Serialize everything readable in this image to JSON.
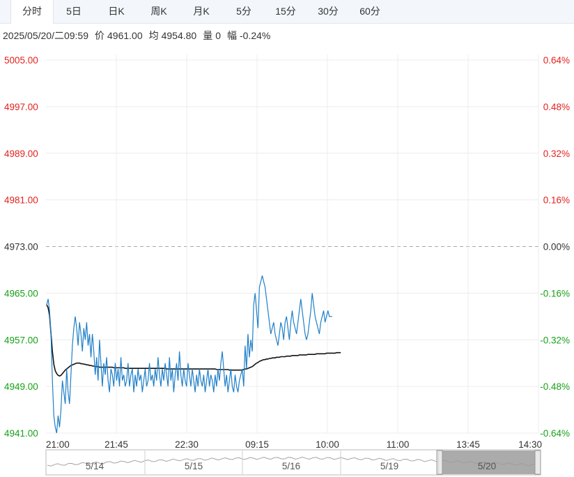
{
  "tabs": [
    {
      "label": "分时",
      "active": true
    },
    {
      "label": "5日",
      "active": false
    },
    {
      "label": "日K",
      "active": false
    },
    {
      "label": "周K",
      "active": false
    },
    {
      "label": "月K",
      "active": false
    },
    {
      "label": "5分",
      "active": false
    },
    {
      "label": "15分",
      "active": false
    },
    {
      "label": "30分",
      "active": false
    },
    {
      "label": "60分",
      "active": false
    }
  ],
  "info": {
    "datetime": "2025/05/20/二09:59",
    "price_label": "价",
    "price": "4961.00",
    "avg_label": "均",
    "avg": "4954.80",
    "volume_label": "量",
    "volume": "0",
    "change_label": "幅",
    "change": "-0.24%"
  },
  "colors": {
    "up": "#e3211c",
    "down": "#18a018",
    "neutral": "#333333",
    "price_line": "#1e7fc8",
    "avg_line": "#111111"
  },
  "chart_data": {
    "type": "line",
    "base_price": 4973.0,
    "ylim": [
      4941,
      5005
    ],
    "y_ticks": [
      "5005.00",
      "4997.00",
      "4989.00",
      "4981.00",
      "4973.00",
      "4965.00",
      "4957.00",
      "4949.00",
      "4941.00"
    ],
    "pct_ticks": [
      "0.64%",
      "0.48%",
      "0.32%",
      "0.16%",
      "0.00%",
      "-0.16%",
      "-0.32%",
      "-0.48%",
      "-0.64%"
    ],
    "x_ticks": [
      "21:00",
      "21:45",
      "22:30",
      "09:15",
      "10:00",
      "11:00",
      "13:45",
      "14:30"
    ],
    "total_slots": 345,
    "series": [
      {
        "values": [
          4963,
          4964,
          4962,
          4958,
          4950,
          4944,
          4942,
          4941,
          4944,
          4942,
          4945,
          4950,
          4948,
          4946,
          4952,
          4948,
          4946,
          4951,
          4956,
          4959,
          4961,
          4959,
          4956,
          4960,
          4958,
          4955,
          4959,
          4957,
          4960,
          4956,
          4958,
          4954,
          4958,
          4955,
          4951,
          4954,
          4950,
          4957,
          4953,
          4949,
          4953,
          4951,
          4954,
          4950,
          4948,
          4952,
          4951,
          4949,
          4953,
          4950,
          4952,
          4949,
          4954,
          4950,
          4951,
          4949,
          4950,
          4953,
          4949,
          4951,
          4952,
          4948,
          4951,
          4949,
          4952,
          4950,
          4951,
          4948,
          4950,
          4952,
          4949,
          4950,
          4953,
          4950,
          4951,
          4949,
          4952,
          4950,
          4954,
          4951,
          4949,
          4952,
          4950,
          4953,
          4951,
          4949,
          4954,
          4950,
          4952,
          4948,
          4951,
          4953,
          4950,
          4955,
          4951,
          4949,
          4952,
          4950,
          4949,
          4953,
          4951,
          4949,
          4952,
          4950,
          4948,
          4951,
          4949,
          4952,
          4950,
          4949,
          4951,
          4948,
          4950,
          4952,
          4949,
          4951,
          4950,
          4948,
          4951,
          4949,
          4952,
          4950,
          4953,
          4955,
          4952,
          4949,
          4951,
          4948,
          4950,
          4952,
          4949,
          4948,
          4951,
          4949,
          4948,
          4950,
          4951,
          4952,
          4949,
          4956,
          4952,
          4958,
          4954,
          4957,
          4955,
          4963,
          4965,
          4962,
          4959,
          4966,
          4967,
          4968,
          4967,
          4966,
          4964,
          4962,
          4960,
          4958,
          4959,
          4960,
          4958,
          4957,
          4956,
          4958,
          4960,
          4959,
          4957,
          4960,
          4961,
          4959,
          4957,
          4960,
          4962,
          4960,
          4959,
          4958,
          4960,
          4962,
          4964,
          4962,
          4960,
          4958,
          4957,
          4958,
          4960,
          4962,
          4965,
          4963,
          4961,
          4960,
          4959,
          4958,
          4960,
          4961,
          4962,
          4960,
          4961,
          4962,
          4961,
          4961,
          4961
        ]
      },
      {
        "values": [
          4963.0,
          4962.5,
          4961.2,
          4958.1,
          4955.0,
          4952.8,
          4951.7,
          4951.2,
          4950.9,
          4950.8,
          4950.9,
          4951.2,
          4951.5,
          4951.8,
          4952.0,
          4952.2,
          4952.4,
          4952.6,
          4952.7,
          4952.8,
          4952.9,
          4953.0,
          4953.0,
          4953.0,
          4952.9,
          4952.9,
          4952.8,
          4952.8,
          4952.7,
          4952.7,
          4952.6,
          4952.6,
          4952.5,
          4952.5,
          4952.4,
          4952.4,
          4952.4,
          4952.3,
          4952.3,
          4952.3,
          4952.3,
          4952.3,
          4952.3,
          4952.3,
          4952.3,
          4952.3,
          4952.3,
          4952.2,
          4952.2,
          4952.2,
          4952.2,
          4952.2,
          4952.2,
          4952.2,
          4952.2,
          4952.1,
          4952.1,
          4952.1,
          4952.1,
          4952.1,
          4952.1,
          4952.1,
          4952.1,
          4952.1,
          4952.1,
          4952.1,
          4952.1,
          4952.1,
          4952.1,
          4952.1,
          4952.1,
          4952.1,
          4952.1,
          4952.1,
          4952.1,
          4952.1,
          4952.1,
          4952.1,
          4952.1,
          4952.1,
          4952.1,
          4952.1,
          4952.1,
          4952.1,
          4952.0,
          4952.0,
          4952.0,
          4952.0,
          4952.0,
          4952.0,
          4952.0,
          4952.0,
          4952.0,
          4952.0,
          4952.0,
          4952.0,
          4952.0,
          4952.0,
          4952.0,
          4952.0,
          4952.0,
          4952.0,
          4952.0,
          4952.0,
          4952.0,
          4952.0,
          4952.0,
          4952.0,
          4952.0,
          4952.0,
          4952.0,
          4952.0,
          4952.0,
          4952.0,
          4952.0,
          4952.0,
          4952.0,
          4952.0,
          4952.0,
          4951.9,
          4951.9,
          4951.9,
          4951.9,
          4951.9,
          4951.9,
          4951.9,
          4951.9,
          4951.9,
          4951.8,
          4951.8,
          4951.8,
          4951.8,
          4951.8,
          4951.8,
          4951.8,
          4951.8,
          4951.8,
          4951.8,
          4951.9,
          4952.0,
          4952.0,
          4952.1,
          4952.2,
          4952.3,
          4952.4,
          4952.6,
          4952.8,
          4953.0,
          4953.1,
          4953.3,
          4953.4,
          4953.5,
          4953.6,
          4953.6,
          4953.7,
          4953.7,
          4953.8,
          4953.8,
          4953.9,
          4953.9,
          4953.9,
          4954.0,
          4954.0,
          4954.0,
          4954.1,
          4954.1,
          4954.1,
          4954.1,
          4954.2,
          4954.2,
          4954.2,
          4954.2,
          4954.3,
          4954.3,
          4954.3,
          4954.3,
          4954.3,
          4954.4,
          4954.4,
          4954.4,
          4954.4,
          4954.4,
          4954.4,
          4954.5,
          4954.5,
          4954.5,
          4954.5,
          4954.5,
          4954.5,
          4954.6,
          4954.6,
          4954.6,
          4954.6,
          4954.6,
          4954.6,
          4954.6,
          4954.7,
          4954.7,
          4954.7,
          4954.7,
          4954.7,
          4954.7,
          4954.7,
          4954.8,
          4954.8,
          4954.8,
          4954.8
        ]
      }
    ],
    "navigator": {
      "labels": [
        "5/14",
        "5/15",
        "5/16",
        "5/19",
        "5/20"
      ]
    }
  }
}
